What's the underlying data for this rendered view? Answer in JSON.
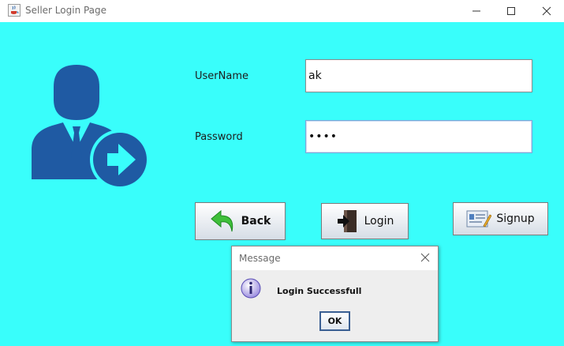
{
  "window": {
    "title": "Seller Login Page",
    "app_icon": "java-cup-icon",
    "controls": [
      "minimize",
      "maximize",
      "close"
    ]
  },
  "form": {
    "username_label": "UserName",
    "username_value": "ak",
    "password_label": "Password",
    "password_value": "••••"
  },
  "buttons": {
    "back_label": "Back",
    "login_label": "Login",
    "signup_label": "Signup"
  },
  "dialog": {
    "title": "Message",
    "message": "Login Successfull",
    "ok_label": "OK",
    "icon": "info-icon"
  },
  "colors": {
    "background": "#39fefb",
    "user_icon": "#1f5aa3"
  }
}
